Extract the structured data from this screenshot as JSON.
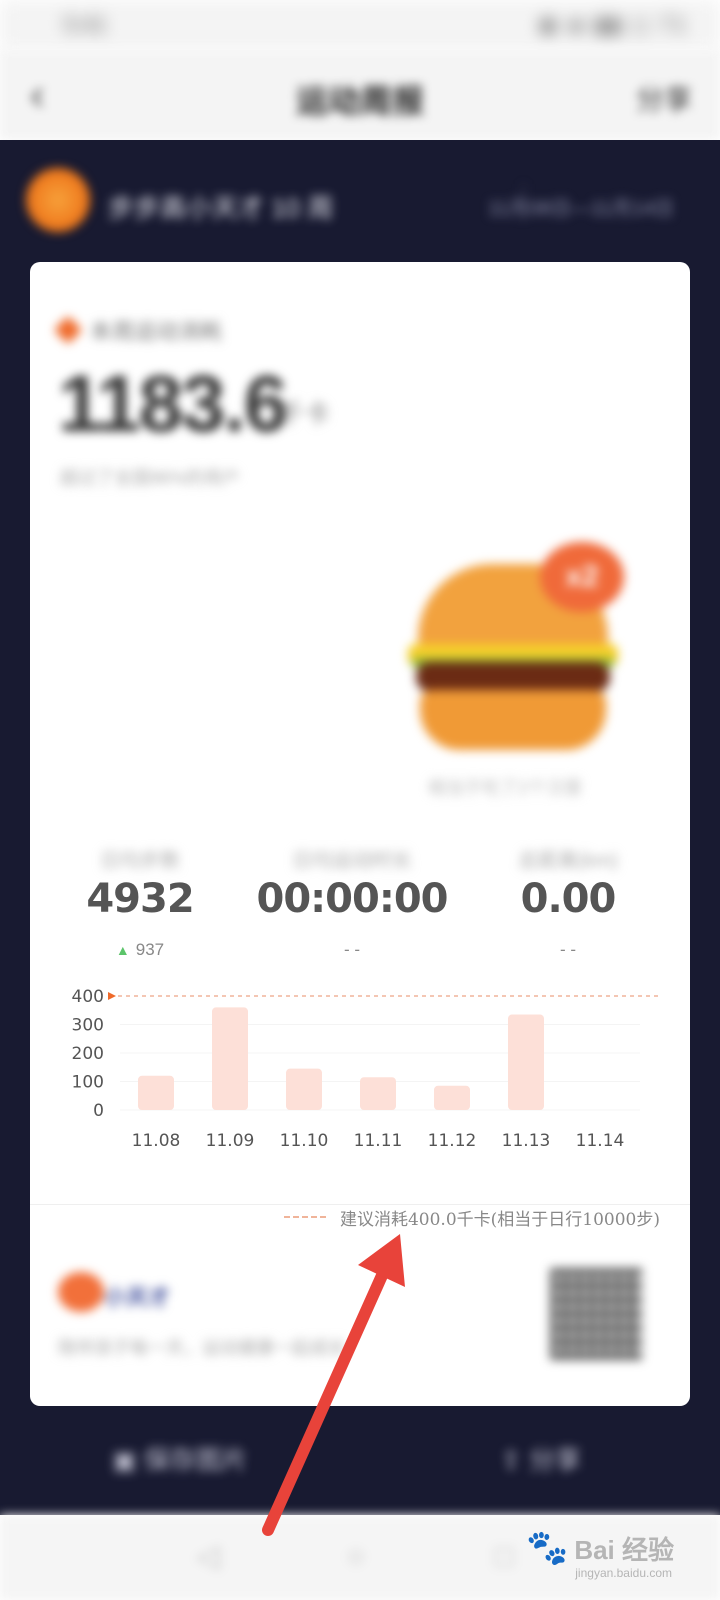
{
  "status_bar": {
    "time": "5:41",
    "icons": "◉ ◈ ▮▮ ◻ 71"
  },
  "title_bar": {
    "title": "运动周报",
    "share": "分享"
  },
  "header": {
    "user": "步步高小天才 10 周",
    "right": "11月08日—11月14日"
  },
  "card": {
    "tag": "本周运动消耗",
    "big_number": "1183.6",
    "unit": "千卡",
    "sub_text": "超过了全国96%的用户",
    "badge": "x2",
    "burger_caption": "相当于吃了2个汉堡"
  },
  "stats": [
    {
      "label": "日均步数",
      "value": "4932",
      "sub": "937",
      "trend": "up"
    },
    {
      "label": "日均运动时长",
      "value": "00:00:00",
      "sub": "- -"
    },
    {
      "label": "总距离(km)",
      "value": "0.00",
      "sub": "- -"
    }
  ],
  "chart_data": {
    "type": "bar",
    "categories": [
      "11.08",
      "11.09",
      "11.10",
      "11.11",
      "11.12",
      "11.13",
      "11.14"
    ],
    "values": [
      120,
      360,
      145,
      115,
      85,
      335,
      0
    ],
    "yticks": [
      0,
      100,
      200,
      300,
      400
    ],
    "ylim": [
      0,
      400
    ],
    "reference_line": 400,
    "bar_color": "#fde0d8",
    "reference_color": "#f0b49a"
  },
  "legend": {
    "text": "建议消耗400.0千卡(相当于日行10000步)"
  },
  "footer": {
    "logo_text": "小天才",
    "slogan": "陪伴孩子每一天，运动健康一起成长"
  },
  "actions": {
    "save": "保存图片",
    "share": "分享"
  },
  "watermark": {
    "text": "Bai 经验",
    "url": "jingyan.baidu.com"
  },
  "colors": {
    "dark_bg": "#181a31",
    "accent": "#ef6a2a",
    "arrow": "#e8433a"
  }
}
